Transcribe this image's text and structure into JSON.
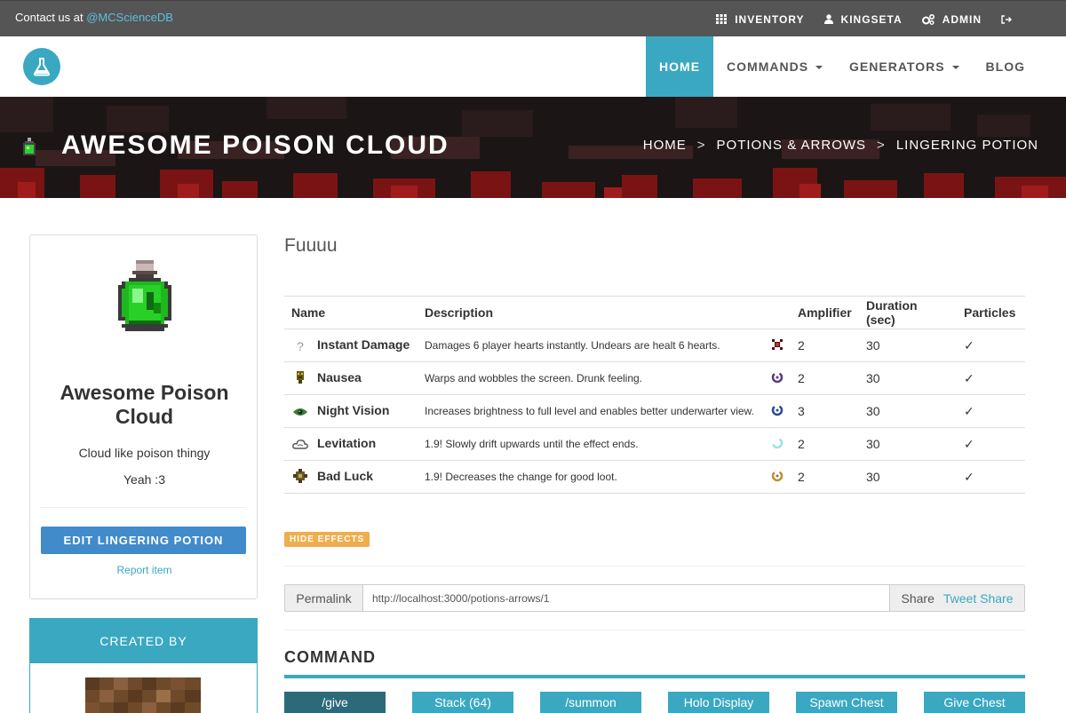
{
  "topbar": {
    "contact_prefix": "Contact us at",
    "contact_handle": "@MCScienceDB",
    "items": [
      {
        "label": "INVENTORY",
        "icon": "grid-icon"
      },
      {
        "label": "KINGSETA",
        "icon": "user-icon"
      },
      {
        "label": "ADMIN",
        "icon": "cogs-icon"
      }
    ],
    "logout_icon": "sign-out-icon"
  },
  "nav": {
    "items": [
      {
        "label": "HOME",
        "active": true
      },
      {
        "label": "COMMANDS",
        "dropdown": true
      },
      {
        "label": "GENERATORS",
        "dropdown": true
      },
      {
        "label": "BLOG"
      }
    ]
  },
  "banner": {
    "title": "AWESOME POISON CLOUD",
    "breadcrumb": [
      "HOME",
      "POTIONS & ARROWS",
      "LINGERING POTION"
    ],
    "separator": ">"
  },
  "item": {
    "title": "Awesome Poison Cloud",
    "description": "Cloud like poison thingy",
    "note": "Yeah :3",
    "edit_label": "EDIT LINGERING POTION",
    "report_label": "Report item"
  },
  "created_by": {
    "heading": "CREATED BY"
  },
  "main": {
    "subtitle": "Fuuuu",
    "columns": [
      "Name",
      "Description",
      "",
      "Amplifier",
      "Duration (sec)",
      "Particles"
    ],
    "effects": [
      {
        "name": "Instant Damage",
        "description": "Damages 6 player hearts instantly. Undears are healt 6 hearts.",
        "amplifier": "2",
        "duration": "30",
        "particles": "✓",
        "icon": "question-icon",
        "fx_color": "#4a1010"
      },
      {
        "name": "Nausea",
        "description": "Warps and wobbles the screen. Drunk feeling.",
        "amplifier": "2",
        "duration": "30",
        "particles": "✓",
        "icon": "nausea-icon",
        "fx_color": "#5a3a7a"
      },
      {
        "name": "Night Vision",
        "description": "Increases brightness to full level and enables better underwarter view.",
        "amplifier": "3",
        "duration": "30",
        "particles": "✓",
        "icon": "eye-icon",
        "fx_color": "#2a4a9a"
      },
      {
        "name": "Levitation",
        "description": "1.9! Slowly drift upwards until the effect ends.",
        "amplifier": "2",
        "duration": "30",
        "particles": "✓",
        "icon": "cloud-icon",
        "fx_color": "#9ae0e8"
      },
      {
        "name": "Bad Luck",
        "description": "1.9! Decreases the change for good loot.",
        "amplifier": "2",
        "duration": "30",
        "particles": "✓",
        "icon": "bad-luck-icon",
        "fx_color": "#c09030"
      }
    ],
    "hide_effects_label": "HIDE EFFECTS",
    "permalink_label": "Permalink",
    "permalink_url": "http://localhost:3000/potions-arrows/1",
    "share_label": "Share",
    "tweet_label": "Tweet Share",
    "command_heading": "COMMAND",
    "command_buttons": [
      "/give",
      "Stack (64)",
      "/summon",
      "Holo Display",
      "Spawn Chest",
      "Give Chest"
    ]
  }
}
